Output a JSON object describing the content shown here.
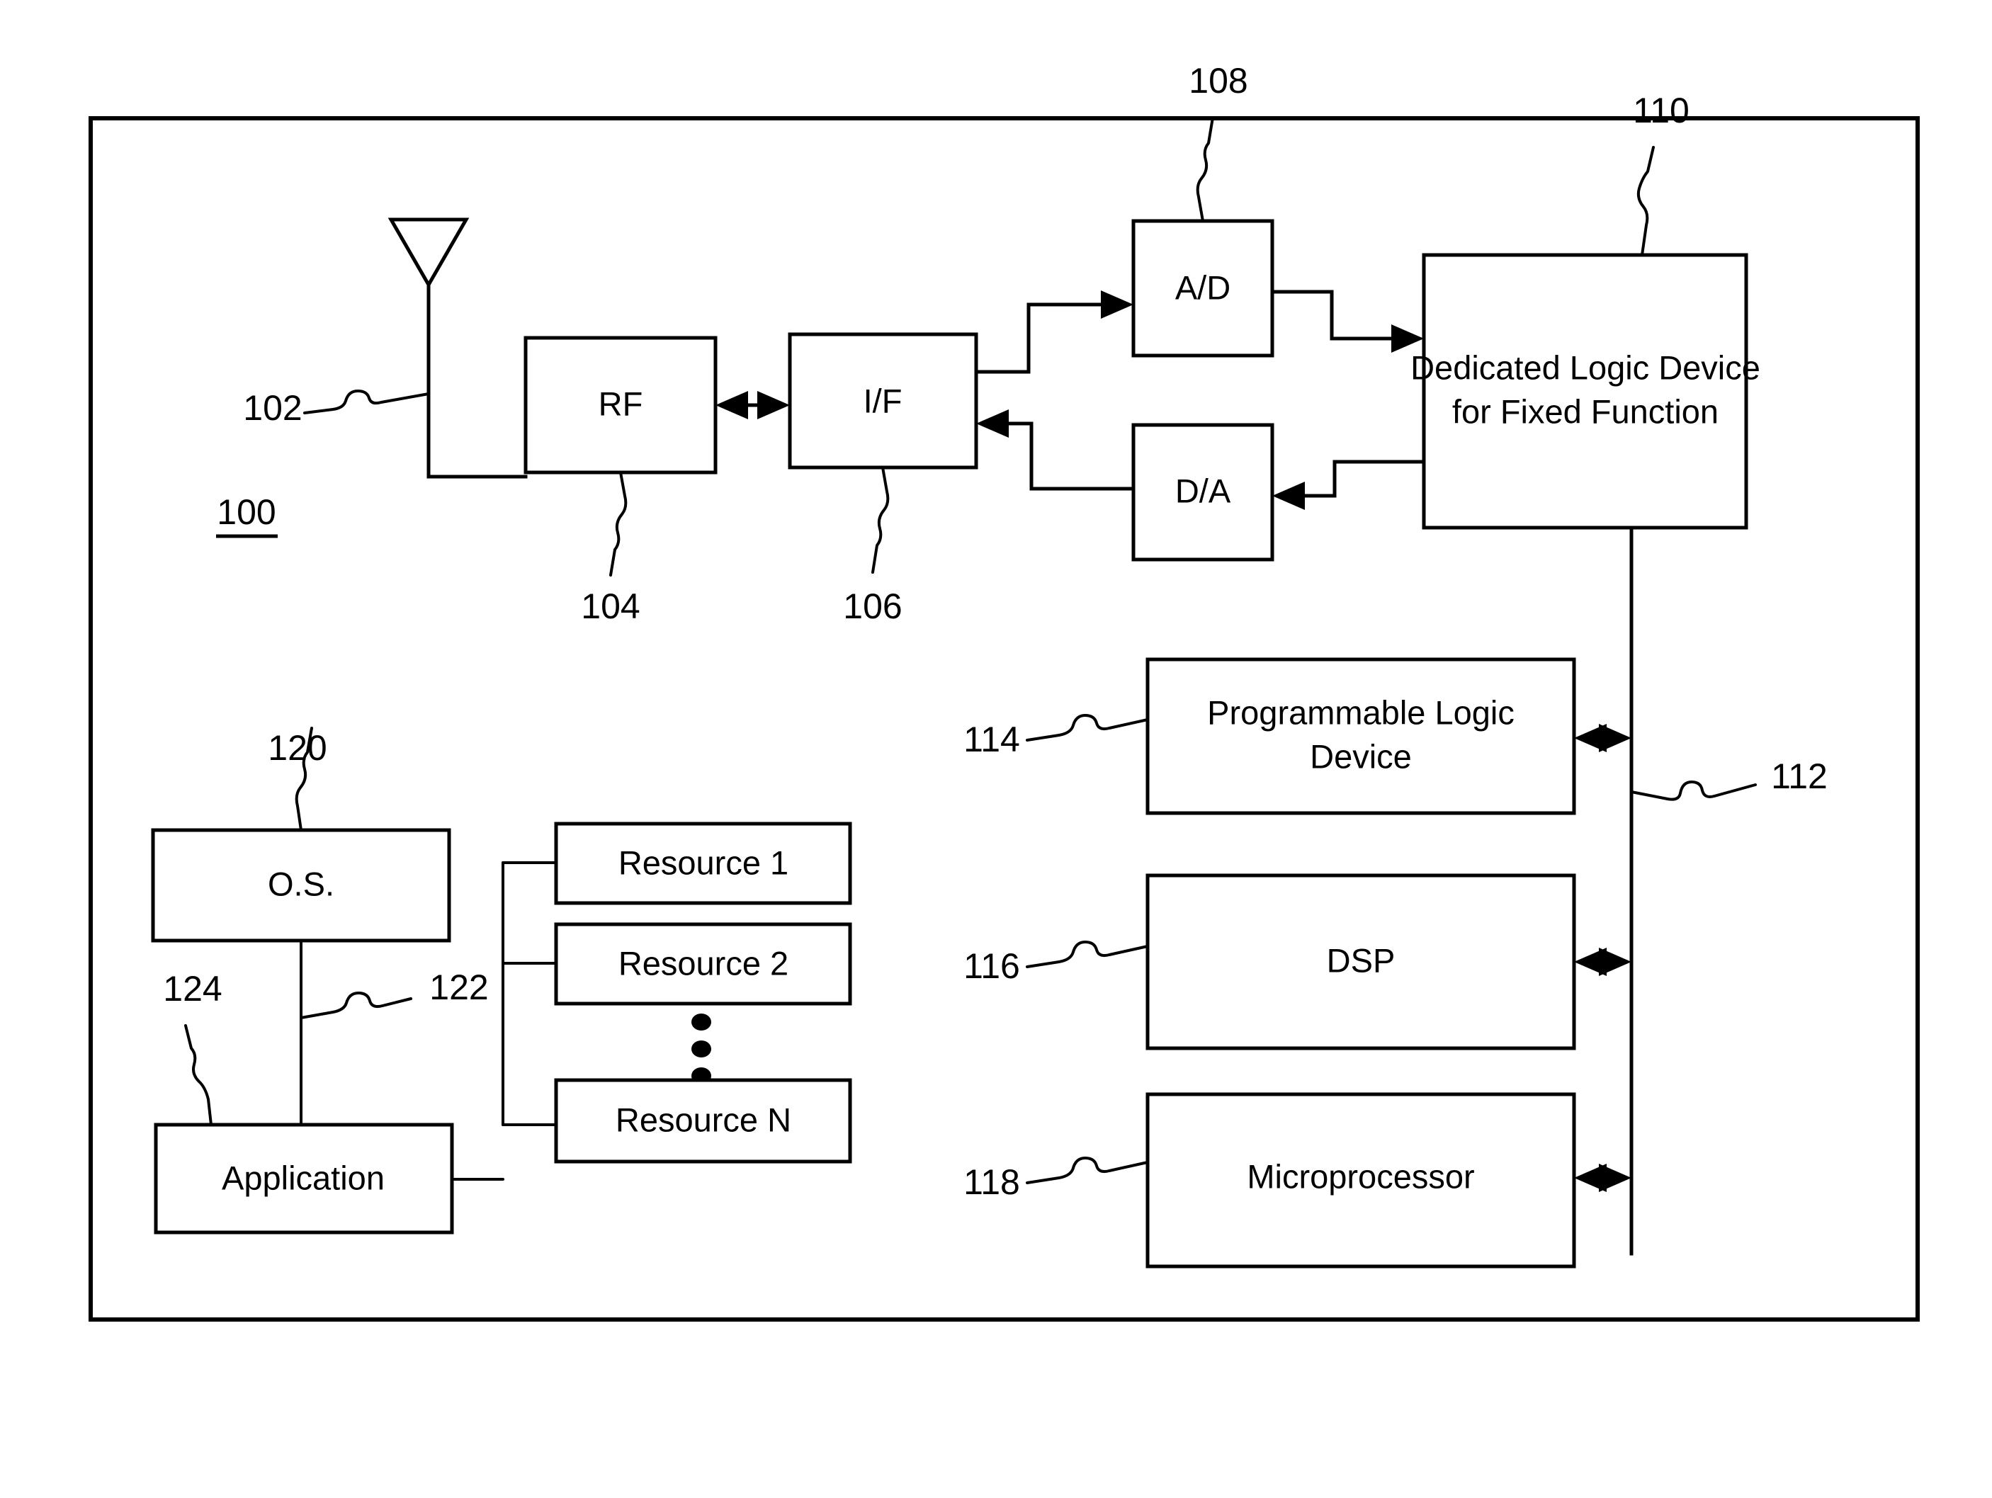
{
  "figure": {
    "title_number": "100",
    "outer_frame_label": "system-boundary"
  },
  "blocks": {
    "rf": {
      "label": "RF",
      "ref": "104"
    },
    "if": {
      "label": "I/F",
      "ref": "106"
    },
    "ad": {
      "label": "A/D",
      "ref": "108"
    },
    "da": {
      "label": "D/A",
      "ref": ""
    },
    "dedicated_logic": {
      "label_line1": "Dedicated Logic Device",
      "label_line2": "for Fixed Function",
      "ref": "110"
    },
    "pld": {
      "label_line1": "Programmable Logic",
      "label_line2": "Device",
      "ref": "114"
    },
    "dsp": {
      "label": "DSP",
      "ref": "116"
    },
    "microprocessor": {
      "label": "Microprocessor",
      "ref": "118"
    },
    "os": {
      "label": "O.S.",
      "ref": "120"
    },
    "application": {
      "label": "Application",
      "ref": "124"
    },
    "resource1": {
      "label": "Resource 1"
    },
    "resource2": {
      "label": "Resource 2"
    },
    "resourceN": {
      "label": "Resource N"
    }
  },
  "refs": {
    "antenna": "102",
    "rf": "104",
    "if": "106",
    "ad": "108",
    "dedicated_logic": "110",
    "bus": "112",
    "pld": "114",
    "dsp": "116",
    "microprocessor": "118",
    "os": "120",
    "os_app_link": "122",
    "application": "124",
    "figure": "100"
  },
  "colors": {
    "ink": "#000000",
    "paper": "#ffffff"
  }
}
